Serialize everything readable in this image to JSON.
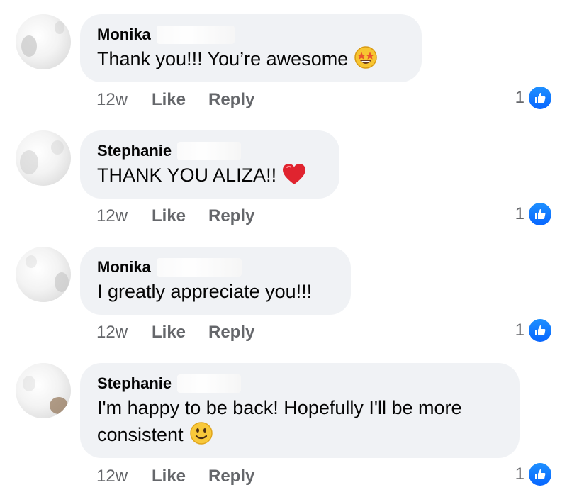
{
  "colors": {
    "bubble": "#f0f2f5",
    "text": "#050505",
    "meta": "#65676b",
    "like_badge": "#0866ff"
  },
  "comments": [
    {
      "name": "Monika",
      "text": "Thank you!!! You’re awesome",
      "emoji": "star-struck-emoji",
      "time": "12w",
      "like_label": "Like",
      "reply_label": "Reply",
      "reaction_count": "1"
    },
    {
      "name": "Stephanie",
      "text": "THANK YOU ALIZA!!",
      "emoji": "red-heart-emoji",
      "time": "12w",
      "like_label": "Like",
      "reply_label": "Reply",
      "reaction_count": "1"
    },
    {
      "name": "Monika",
      "text": "I greatly appreciate you!!!",
      "emoji": "",
      "time": "12w",
      "like_label": "Like",
      "reply_label": "Reply",
      "reaction_count": "1"
    },
    {
      "name": "Stephanie",
      "text_line1": "I'm happy to be back! Hopefully I'll be more",
      "text_line2": "consistent",
      "emoji": "slightly-smiling-face-emoji",
      "time": "12w",
      "like_label": "Like",
      "reply_label": "Reply",
      "reaction_count": "1"
    }
  ]
}
